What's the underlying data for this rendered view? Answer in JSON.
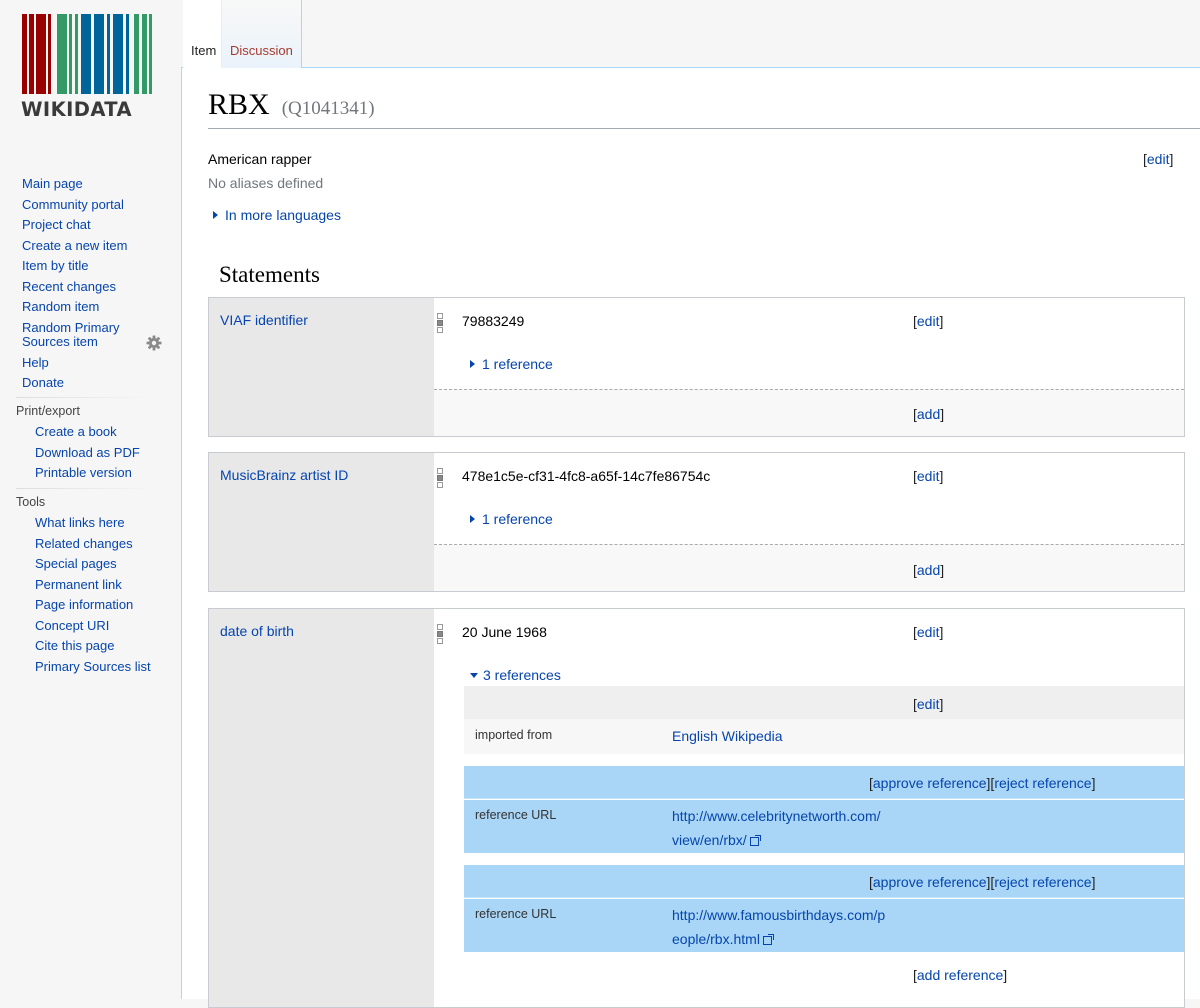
{
  "logo": {
    "wordmark": "WIKIDATA",
    "bar_colors": [
      "#990000",
      "#339966",
      "#006699"
    ]
  },
  "sidebar": {
    "navigation": [
      "Main page",
      "Community portal",
      "Project chat",
      "Create a new item",
      "Item by title",
      "Recent changes",
      "Random item",
      "Random Primary Sources item",
      "Help",
      "Donate"
    ],
    "print_export": {
      "title": "Print/export",
      "items": [
        "Create a book",
        "Download as PDF",
        "Printable version"
      ]
    },
    "tools": {
      "title": "Tools",
      "items": [
        "What links here",
        "Related changes",
        "Special pages",
        "Permanent link",
        "Page information",
        "Concept URI",
        "Cite this page",
        "Primary Sources list"
      ]
    },
    "gear_icon": "gear-icon"
  },
  "tabs": {
    "item": "Item",
    "discussion": "Discussion"
  },
  "item": {
    "label": "RBX",
    "id": "(Q1041341)",
    "description": "American rapper",
    "aliases": "No aliases defined",
    "more_languages": "In more languages",
    "edit": "edit"
  },
  "statements": {
    "heading": "Statements",
    "groups": [
      {
        "property": "VIAF identifier",
        "value": "79883249",
        "references": "1 reference",
        "edit": "edit",
        "add": "add"
      },
      {
        "property": "MusicBrainz artist ID",
        "value": "478e1c5e-cf31-4fc8-a65f-14c7fe86754c",
        "references": "1 reference",
        "edit": "edit",
        "add": "add"
      },
      {
        "property": "date of birth",
        "value": "20 June 1968",
        "references": "3 references",
        "edit": "edit",
        "reference_list": [
          {
            "actions": [
              "edit"
            ],
            "key": "imported from",
            "value": "English Wikipedia"
          },
          {
            "actions": [
              "approve reference",
              "reject reference"
            ],
            "key": "reference URL",
            "value_lines": [
              "http://www.celebritynetworth.com/",
              "view/en/rbx/"
            ]
          },
          {
            "actions": [
              "approve reference",
              "reject reference"
            ],
            "key": "reference URL",
            "value_lines": [
              "http://www.famousbirthdays.com/p",
              "eople/rbx.html"
            ]
          }
        ],
        "add_reference": "add reference"
      }
    ]
  }
}
